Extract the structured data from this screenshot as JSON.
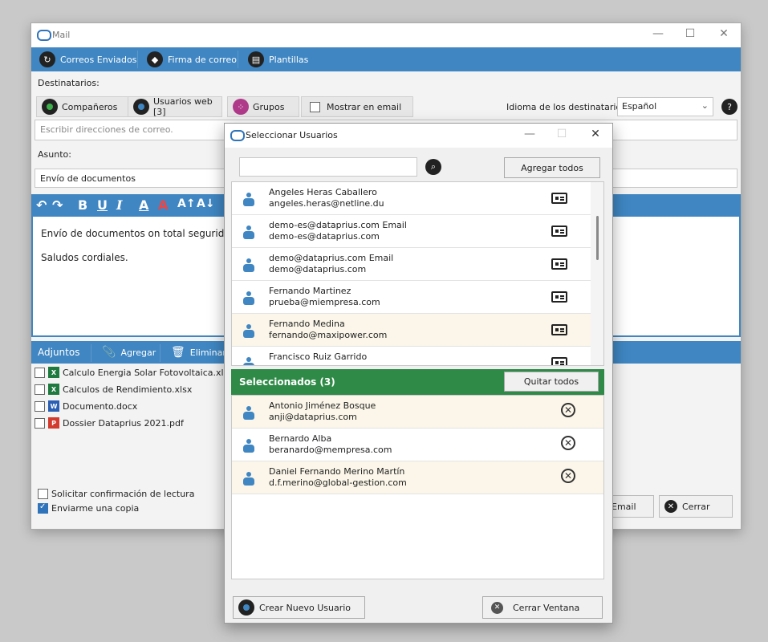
{
  "main": {
    "title": "Mail",
    "toolbar": [
      "Correos Enviados",
      "Firma de correo",
      "Plantillas"
    ],
    "destinatarios_label": "Destinatarios:",
    "recipient_buttons": [
      "Compañeros",
      "Usuarios web [3]",
      "Grupos"
    ],
    "mostrar_email": "Mostrar en email",
    "idioma_label": "Idioma de los destinatarios:",
    "idioma_value": "Español",
    "email_placeholder": "Escribir direcciones de correo.",
    "asunto_label": "Asunto:",
    "asunto_value": "Envío de documentos",
    "body_line1": "Envío de documentos on total seguridad de",
    "body_line2": "Saludos cordiales.",
    "adjuntos_label": "Adjuntos",
    "agregar_label": "Agregar",
    "eliminar_label": "Eliminar",
    "attachments": [
      {
        "name": "Calculo Energia Solar Fotovoltaica.xlsx",
        "type": "xlsx"
      },
      {
        "name": "Calculos de Rendimiento.xlsx",
        "type": "xlsx"
      },
      {
        "name": "Documento.docx",
        "type": "docx"
      },
      {
        "name": "Dossier Dataprius 2021.pdf",
        "type": "pdf"
      }
    ],
    "options": [
      {
        "label": "Solicitar confirmación de lectura",
        "checked": false
      },
      {
        "label": "Enviarme una copia",
        "checked": true
      }
    ],
    "send_label": "Email",
    "close_label": "Cerrar"
  },
  "dialog": {
    "title": "Seleccionar Usuarios",
    "search_value": "",
    "agregar_todos": "Agregar todos",
    "users": [
      {
        "name": "Angeles Heras Caballero",
        "email": "angeles.heras@netline.du",
        "highlight": false
      },
      {
        "name": "demo-es@dataprius.com Email",
        "email": "demo-es@dataprius.com",
        "highlight": false
      },
      {
        "name": "demo@dataprius.com Email",
        "email": "demo@dataprius.com",
        "highlight": false
      },
      {
        "name": "Fernando Martinez",
        "email": "prueba@miempresa.com",
        "highlight": false
      },
      {
        "name": "Fernando Medina",
        "email": "fernando@maxipower.com",
        "highlight": true
      },
      {
        "name": "Francisco Ruiz Garrido",
        "email": "",
        "highlight": false
      }
    ],
    "seleccionados_label": "Seleccionados (3)",
    "quitar_todos": "Quitar todos",
    "selected": [
      {
        "name": "Antonio Jiménez Bosque",
        "email": "anji@dataprius.com"
      },
      {
        "name": "Bernardo Alba",
        "email": "beranardo@mempresa.com"
      },
      {
        "name": "Daniel Fernando Merino Martín",
        "email": "d.f.merino@global-gestion.com"
      }
    ],
    "crear_usuario": "Crear Nuevo Usuario",
    "cerrar_ventana": "Cerrar Ventana"
  },
  "colors": {
    "accent": "#3f86c2",
    "selected_header": "#2f8a47",
    "row_highlight": "#fbf6e9"
  }
}
